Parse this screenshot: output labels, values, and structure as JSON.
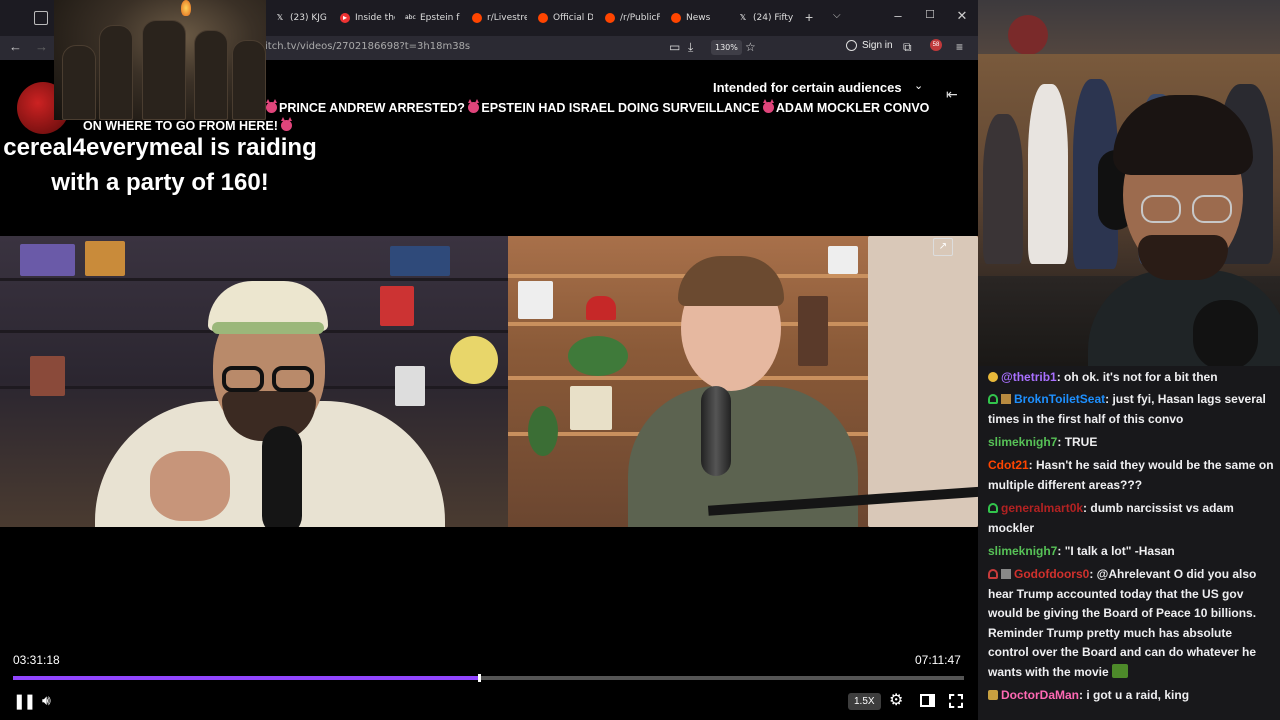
{
  "browser": {
    "tabs": [
      {
        "label": "(23) KJG",
        "icon": "x-logo-icon"
      },
      {
        "label": "Inside the",
        "icon": "youtube-icon"
      },
      {
        "label": "Epstein fr",
        "icon": "abc-icon"
      },
      {
        "label": "r/Livestre",
        "icon": "reddit-icon"
      },
      {
        "label": "Official D",
        "icon": "reddit-icon"
      },
      {
        "label": "/r/PublicF",
        "icon": "reddit-icon"
      },
      {
        "label": "News",
        "icon": "reddit-icon"
      },
      {
        "label": "(24) Fifty",
        "icon": "x-logo-icon"
      }
    ],
    "url": "itch.tv/videos/2702186698?t=3h18m38s",
    "zoom": "130%",
    "sign_in": "Sign in",
    "extension_badge": "58",
    "colors": {
      "tabbar": "#1c1b22",
      "navbar": "#2b2a33"
    }
  },
  "video": {
    "audience_label": "Intended for certain audiences",
    "title_line1": "PRINCE ANDREW ARRESTED?",
    "title_line1b": "EPSTEIN HAD ISRAEL DOING SURVEILLANCE",
    "title_line1c": "ADAM MOCKLER CONVO",
    "title_line2": "ON WHERE TO GO FROM HERE!",
    "raid_text": "cereal4everymeal is raiding with a party of 160!",
    "current_time": "03:31:18",
    "total_time": "07:11:47",
    "progress": 0.49,
    "speed": "1.5X",
    "accent": "#9146ff"
  },
  "chat": {
    "messages": [
      {
        "badge": "badge-sub",
        "user": "@thetrib1",
        "color": "#a970ff",
        "text": ": oh ok. it's not for a bit then"
      },
      {
        "badge": "badge-gift",
        "user": "BroknToiletSeat",
        "color": "#1e90ff",
        "text": ": just fyi, Hasan lags several times in the first half of this convo"
      },
      {
        "badge": "",
        "user": "slimeknigh7",
        "color": "#57c257",
        "text": ": TRUE"
      },
      {
        "badge": "",
        "user": "Cdot21",
        "color": "#ff4500",
        "text": ": Hasn't he said they would be the same on multiple different areas???"
      },
      {
        "badge": "badge-gift",
        "user": "generalmart0k",
        "color": "#b22222",
        "text": ": dumb narcissist vs adam mockler"
      },
      {
        "badge": "",
        "user": "slimeknigh7",
        "color": "#57c257",
        "text": ": \"I talk a lot\" -Hasan"
      },
      {
        "badge": "badge-red",
        "user": "Godofdoors0",
        "color": "#d0312d",
        "text": ": @Ahrelevant O did you also hear Trump accounted today that the US gov would be giving the Board of Peace 10 billions. Reminder Trump pretty much has absolute control over the Board and can do whatever he wants with the movie"
      },
      {
        "badge": "badge-gold",
        "user": "DoctorDaMan",
        "color": "#ff69b4",
        "text": ": i got u a raid, king"
      }
    ]
  }
}
